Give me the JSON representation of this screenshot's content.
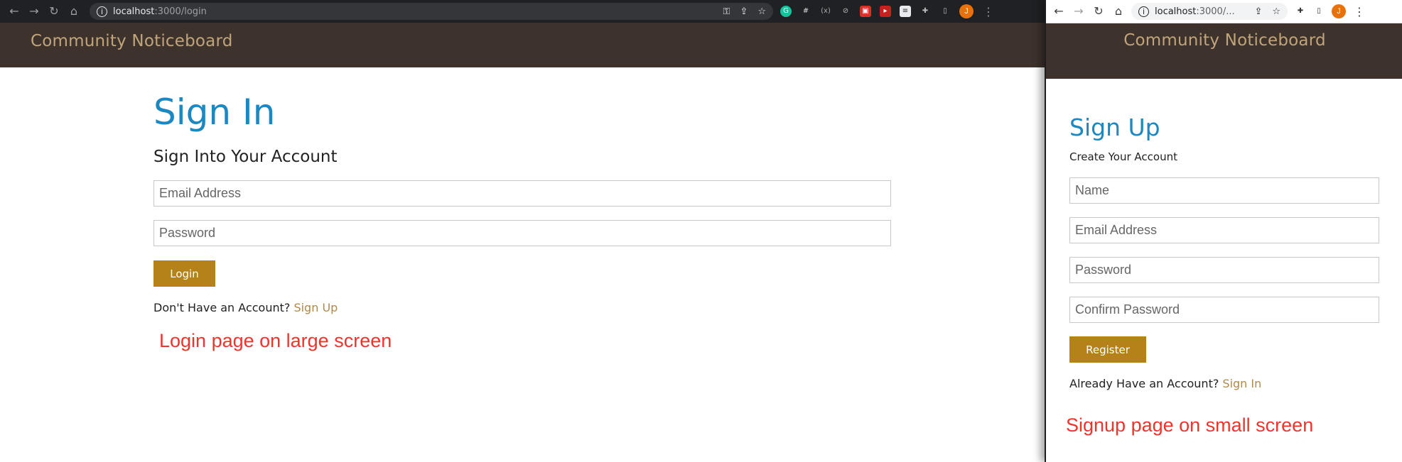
{
  "large": {
    "browser": {
      "url_host": "localhost",
      "url_path": ":3000/login"
    },
    "navbar": {
      "brand": "Community Noticeboard"
    },
    "form": {
      "title": "Sign In",
      "subtitle": "Sign Into Your Account",
      "email_placeholder": "Email Address",
      "password_placeholder": "Password",
      "submit_label": "Login",
      "switch_text": "Don't Have an Account? ",
      "switch_link": "Sign Up"
    },
    "caption": "Login page on large screen"
  },
  "small": {
    "browser": {
      "url_host": "localhost",
      "url_path": ":3000/..."
    },
    "navbar": {
      "brand": "Community Noticeboard"
    },
    "form": {
      "title": "Sign Up",
      "subtitle": "Create Your Account",
      "name_placeholder": "Name",
      "email_placeholder": "Email Address",
      "password_placeholder": "Password",
      "confirm_placeholder": "Confirm Password",
      "submit_label": "Register",
      "switch_text": "Already Have an Account? ",
      "switch_link": "Sign In"
    },
    "caption": "Signup page on small screen"
  },
  "avatar_initial": "J",
  "colors": {
    "navbar_bg": "#3d322c",
    "brand": "#c0a47c",
    "title": "#1c87c0",
    "button": "#b48218",
    "link": "#b0894a",
    "caption": "#f0342c"
  }
}
